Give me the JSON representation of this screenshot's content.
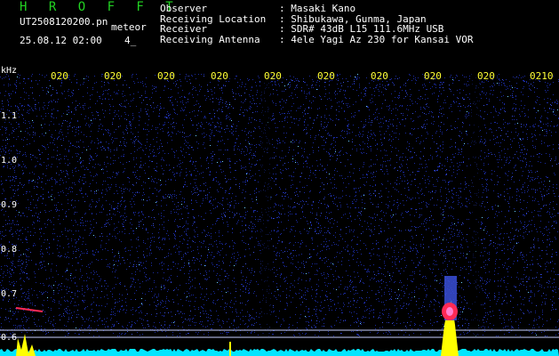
{
  "header": {
    "brand": "H R O F F T",
    "filename": "UT2508120200.pn",
    "mode": "meteor",
    "datetime": "25.08.12 02:00",
    "count": "4_",
    "info": [
      {
        "label": "Observer",
        "value": ": Masaki Kano"
      },
      {
        "label": "Receiving Location",
        "value": ": Shibukawa, Gunma, Japan"
      },
      {
        "label": "Receiver",
        "value": ": SDR# 43dB L15 111.6MHz USB"
      },
      {
        "label": "Receiving Antenna",
        "value": ": 4ele Yagi Az 230 for Kansai VOR"
      }
    ]
  },
  "spectrogram": {
    "y_unit": "kHz",
    "y_ticks": [
      "1.1",
      "1.0",
      "0.9",
      "0.8",
      "0.7",
      "0.6"
    ],
    "x_ticks": [
      "020",
      "020",
      "020",
      "020",
      "020",
      "020",
      "020",
      "020",
      "020",
      "0210"
    ],
    "colors": {
      "background": "#000000",
      "noise_blue": "#1a2aa0",
      "signal_cyan": "#00e5ff",
      "signal_yellow": "#ffff00",
      "signal_red": "#ff2a55",
      "label_yellow": "#ffff33",
      "brand_green": "#22d322"
    }
  }
}
